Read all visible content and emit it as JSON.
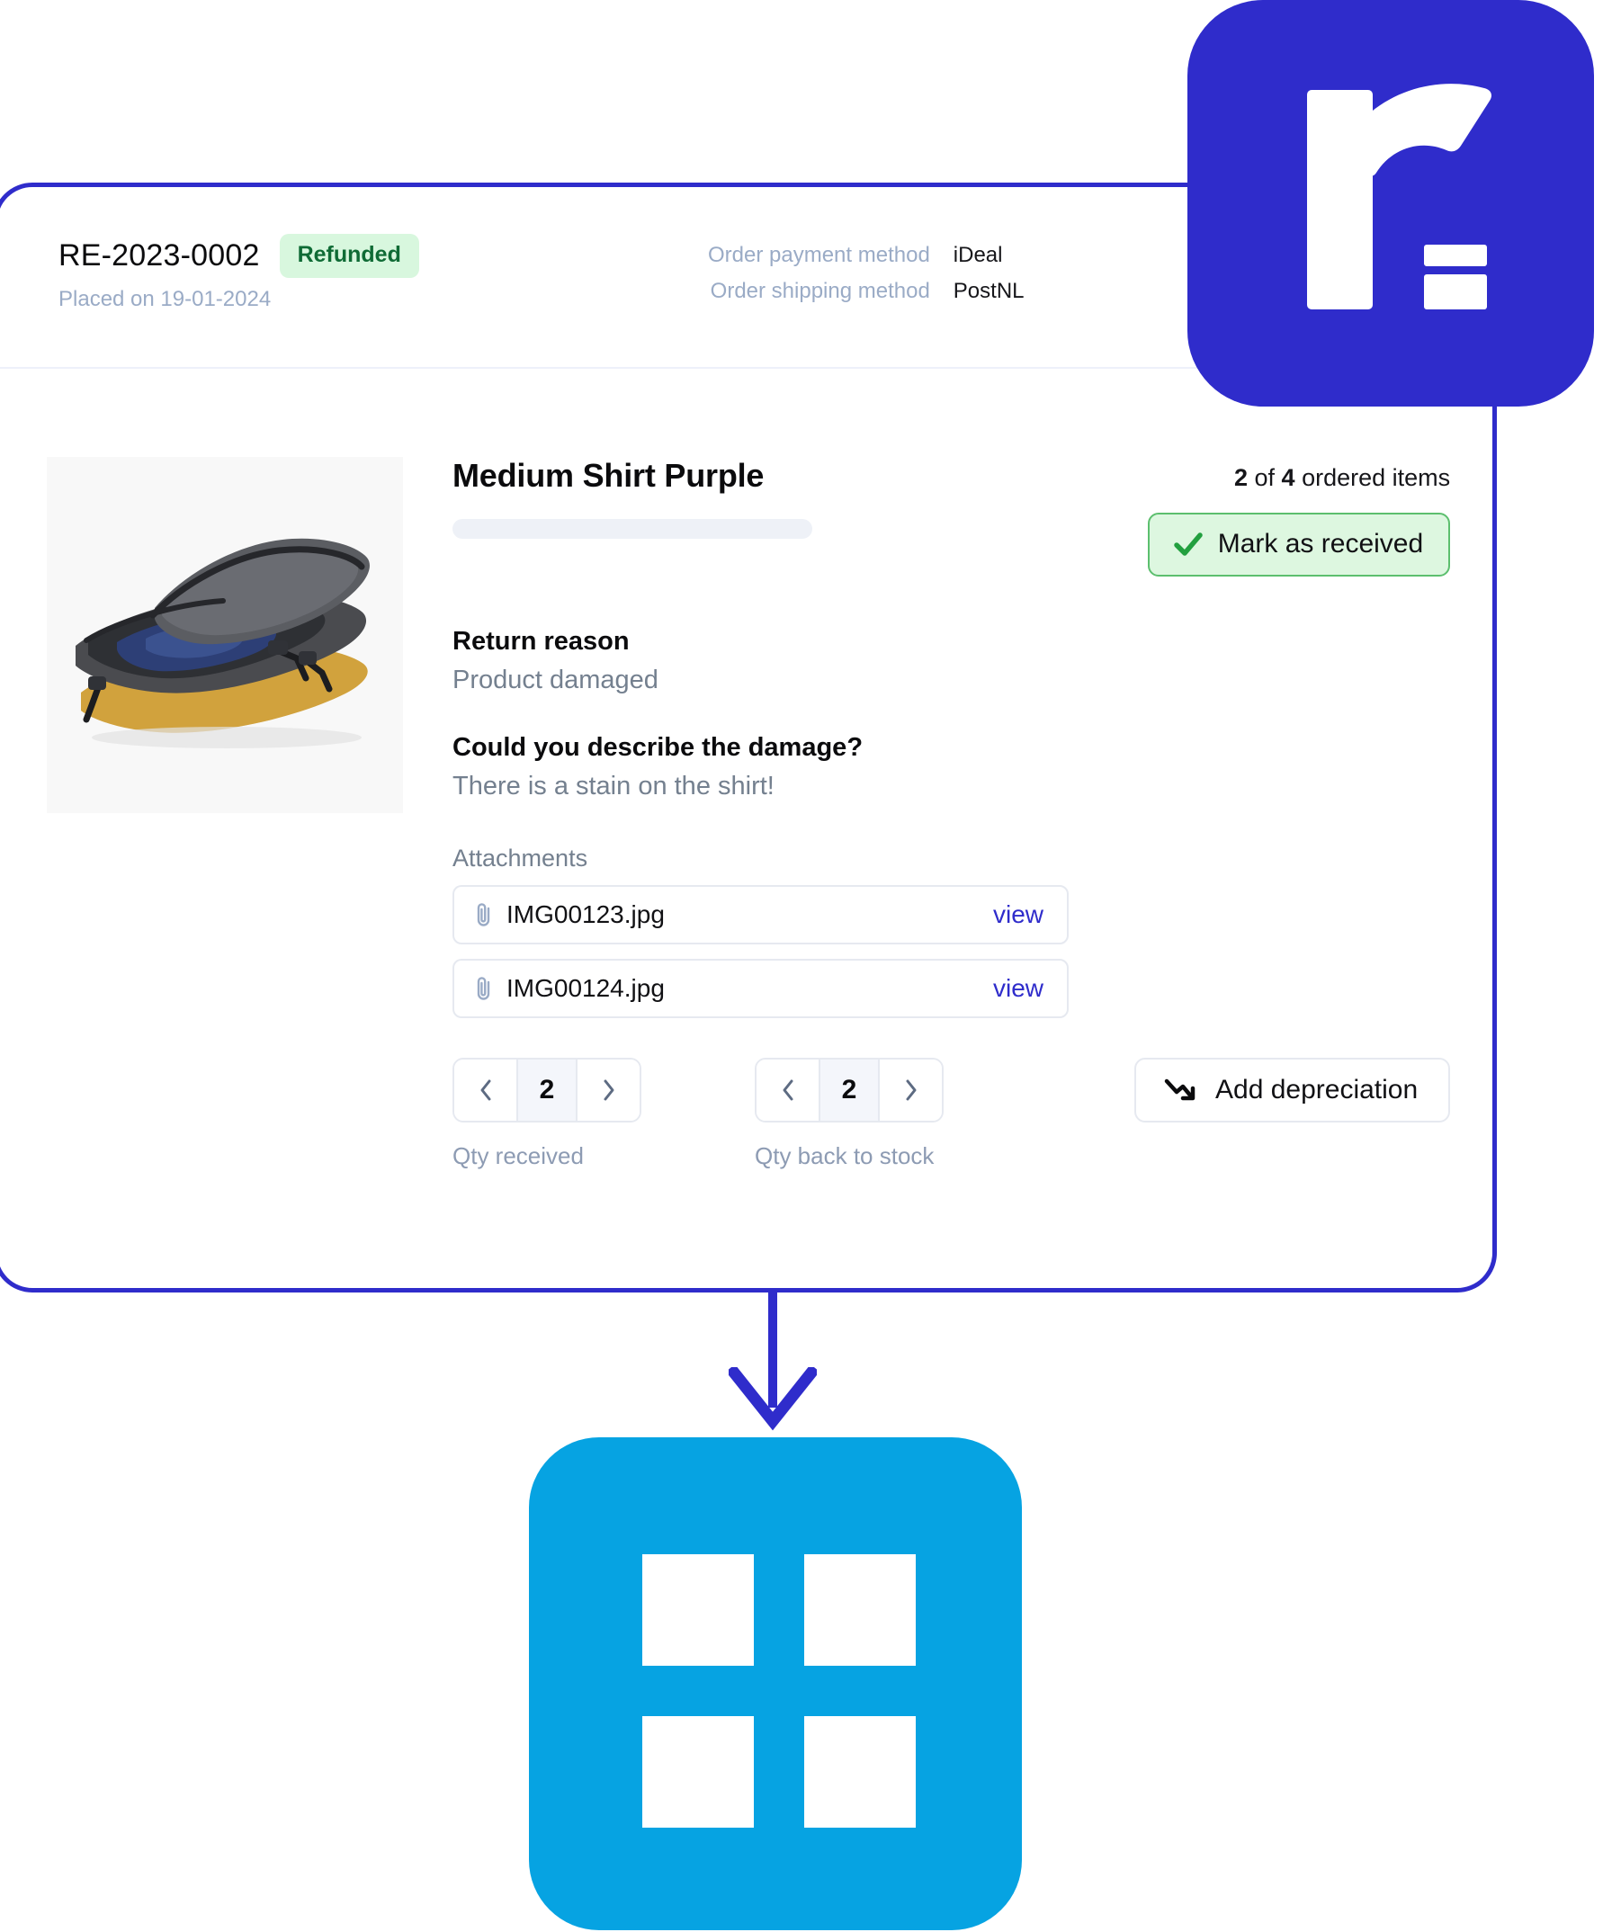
{
  "card": {
    "header": {
      "return_id": "RE-2023-0002",
      "status": "Refunded",
      "placed_on": "Placed on 19-01-2024",
      "payment_label": "Order payment method",
      "payment_value": "iDeal",
      "shipping_label": "Order shipping method",
      "shipping_value": "PostNL"
    },
    "product": {
      "title": "Medium Shirt Purple",
      "ordered_received": "2",
      "ordered_of": "of",
      "ordered_total": "4",
      "ordered_suffix": "ordered items",
      "mark_received_label": "Mark as received"
    },
    "questions": [
      {
        "question": "Return reason",
        "answer": "Product damaged"
      },
      {
        "question": "Could you describe the damage?",
        "answer": "There is a stain on the shirt!"
      }
    ],
    "attachments": {
      "label": "Attachments",
      "view_label": "view",
      "items": [
        {
          "filename": "IMG00123.jpg"
        },
        {
          "filename": "IMG00124.jpg"
        }
      ]
    },
    "controls": {
      "qty_received": {
        "value": "2",
        "caption": "Qty received"
      },
      "qty_back_to_stock": {
        "value": "2",
        "caption": "Qty back to stock"
      },
      "add_depreciation_label": "Add depreciation"
    }
  },
  "colors": {
    "brand_purple": "#2f2ccb",
    "brand_cyan": "#06a3e2",
    "status_green_text": "#0f6b35",
    "status_green_bg": "#d8f7de",
    "link_blue": "#2f2ccb",
    "muted_text": "#9aabc6"
  }
}
